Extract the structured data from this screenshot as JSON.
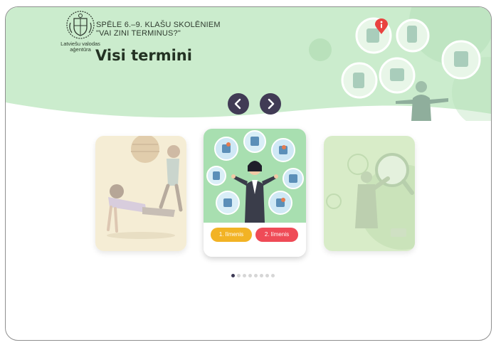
{
  "branding": {
    "logo_line1": "Latviešu valodas",
    "logo_line2": "aģentūra"
  },
  "header": {
    "subtitle": "SPĒLE 6.–9. KLAŠU SKOLĒNIEM\n\"VAI ZINI TERMINUS?\"",
    "title": "Visi termini",
    "info_icon": "info-icon"
  },
  "navigation": {
    "prev_icon": "chevron-left-icon",
    "next_icon": "chevron-right-icon"
  },
  "cards": {
    "center": {
      "level_1_label": "1. līmenis",
      "level_2_label": "2. līmenis"
    }
  },
  "pagination": {
    "total": 8,
    "active_index": 0
  },
  "colors": {
    "header_green": "#cbeccd",
    "nav_dark": "#413b55",
    "level_1": "#f2b325",
    "level_2": "#ef4b57",
    "info_red": "#e9423f"
  }
}
